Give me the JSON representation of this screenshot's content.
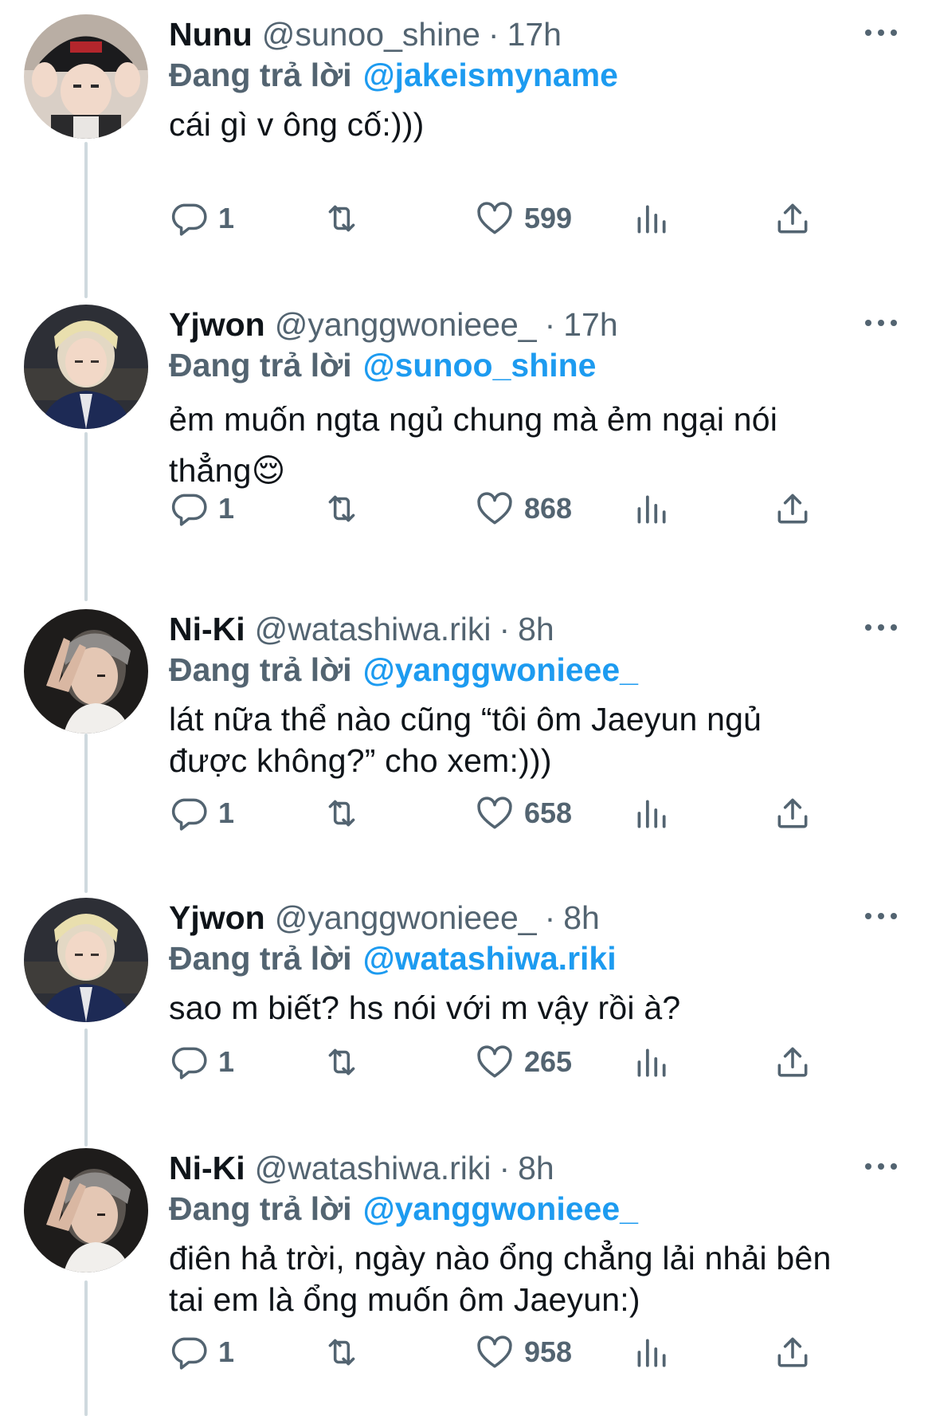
{
  "colors": {
    "accent": "#1d9bf0",
    "text": "#0f1419",
    "secondary": "#536471",
    "thread_line": "#cfd9de"
  },
  "tweets": [
    {
      "name": "Nunu",
      "handle": "@sunoo_shine",
      "dot": "·",
      "time": "17h",
      "replying_label": "Đang trả lời",
      "replying_to": "@jakeismyname",
      "text_lines": [
        "cái gì v ông cố:)))"
      ],
      "reply_count": "1",
      "like_count": "599",
      "avatar_icon": "avatar-black-cap"
    },
    {
      "name": "Yjwon",
      "handle": "@yanggwonieee_",
      "dot": "·",
      "time": "17h",
      "replying_label": "Đang trả lời",
      "replying_to": "@sunoo_shine",
      "text_lines": [
        "ẻm muốn ngta ngủ chung mà ẻm ngại nói",
        "thẳng😌"
      ],
      "reply_count": "1",
      "like_count": "868",
      "avatar_icon": "avatar-blonde-navy-jacket"
    },
    {
      "name": "Ni-Ki",
      "handle": "@watashiwa.riki",
      "dot": "·",
      "time": "8h",
      "replying_label": "Đang trả lời",
      "replying_to": "@yanggwonieee_",
      "text_lines": [
        "lát nữa thể nào cũng “tôi ôm Jaeyun ngủ",
        "được không?” cho xem:)))"
      ],
      "reply_count": "1",
      "like_count": "658",
      "avatar_icon": "avatar-peace-sign"
    },
    {
      "name": "Yjwon",
      "handle": "@yanggwonieee_",
      "dot": "·",
      "time": "8h",
      "replying_label": "Đang trả lời",
      "replying_to": "@watashiwa.riki",
      "text_lines": [
        "sao m biết? hs nói với m vậy rồi à?"
      ],
      "reply_count": "1",
      "like_count": "265",
      "avatar_icon": "avatar-blonde-navy-jacket"
    },
    {
      "name": "Ni-Ki",
      "handle": "@watashiwa.riki",
      "dot": "·",
      "time": "8h",
      "replying_label": "Đang trả lời",
      "replying_to": "@yanggwonieee_",
      "text_lines": [
        "điên hả trời, ngày nào ổng chẳng lải nhải bên",
        "tai em là ổng muốn ôm Jaeyun:)"
      ],
      "reply_count": "1",
      "like_count": "958",
      "avatar_icon": "avatar-peace-sign"
    }
  ]
}
